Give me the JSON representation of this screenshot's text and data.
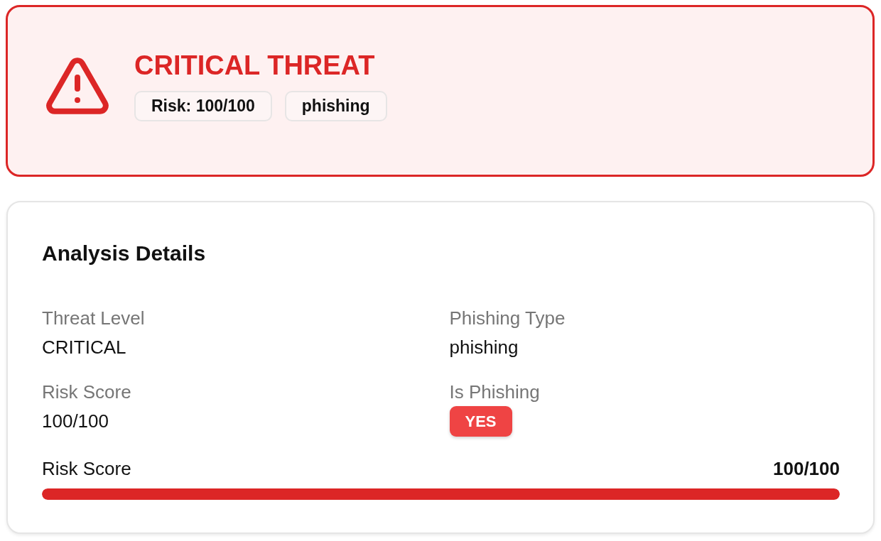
{
  "alert": {
    "title": "CRITICAL THREAT",
    "badges": [
      "Risk: 100/100",
      "phishing"
    ]
  },
  "details": {
    "title": "Analysis Details",
    "fields": [
      {
        "label": "Threat Level",
        "value": "CRITICAL",
        "kind": "text"
      },
      {
        "label": "Phishing Type",
        "value": "phishing",
        "kind": "text"
      },
      {
        "label": "Risk Score",
        "value": "100/100",
        "kind": "text"
      },
      {
        "label": "Is Phishing",
        "value": "YES",
        "kind": "badge"
      }
    ],
    "risk_meter": {
      "label": "Risk Score",
      "reading": "100/100",
      "level": 1
    }
  }
}
